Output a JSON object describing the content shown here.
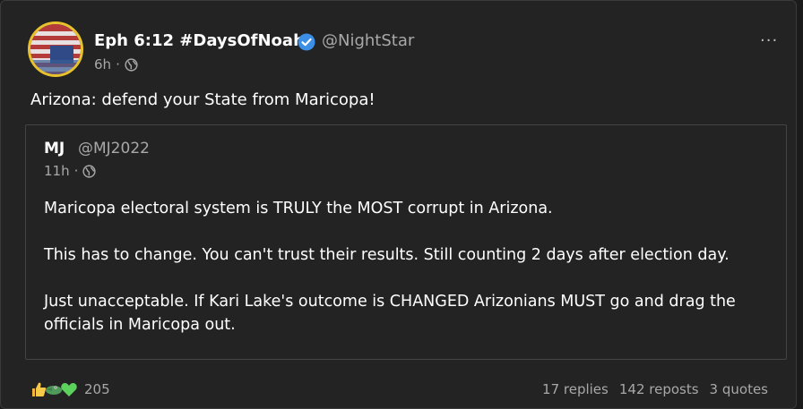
{
  "post": {
    "author_name": "Eph 6:12 #DaysOfNoah",
    "author_handle": "@NightStar",
    "time": "6h",
    "separator": "·",
    "text": "Arizona: defend your State from Maricopa!",
    "visibility_icon": "globe-icon",
    "more_label": "···"
  },
  "quote": {
    "author_name": "MJ",
    "author_handle": "@MJ2022",
    "time": "11h",
    "separator": "·",
    "paragraphs": [
      "Maricopa electoral system is TRULY the MOST corrupt in Arizona.",
      "This has to change. You can't trust their results. Still counting 2 days after election day.",
      "Just unacceptable. If Kari Lake's outcome is CHANGED Arizonians MUST go and drag the officials in Maricopa out."
    ]
  },
  "footer": {
    "reaction_icons": [
      "thumbs-up-icon",
      "crocodile-icon",
      "green-heart-icon"
    ],
    "reaction_count": "205",
    "replies": "17 replies",
    "reposts": "142 reposts",
    "quotes": "3 quotes"
  },
  "colors": {
    "background": "#232323",
    "muted_text": "#a8a8a8",
    "verified_blue": "#3b8fe6",
    "avatar_ring": "#e7c22c"
  }
}
